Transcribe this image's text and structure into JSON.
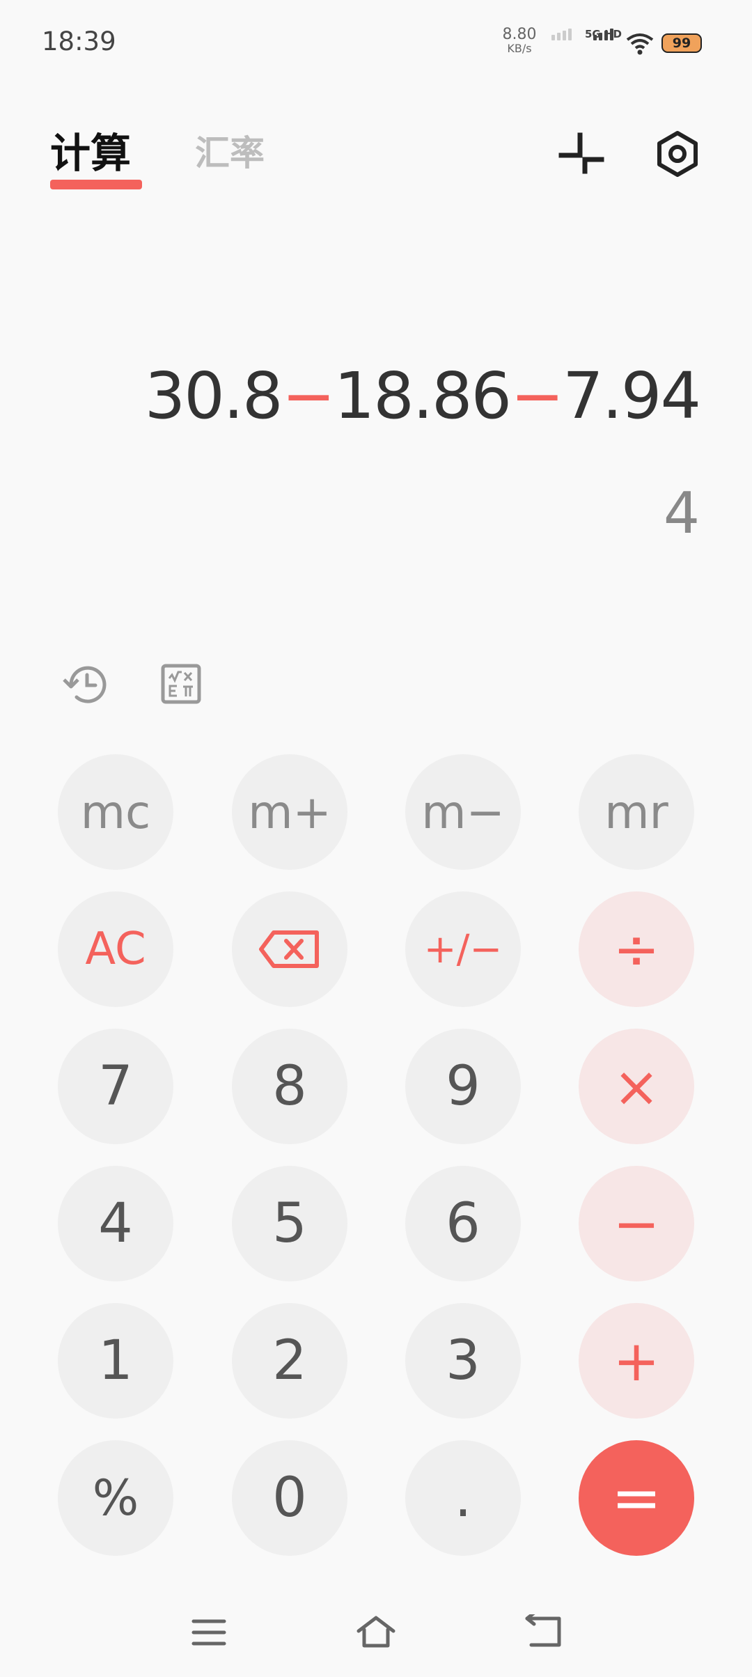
{
  "status": {
    "time": "18:39",
    "speed_value": "8.80",
    "speed_unit": "KB/s",
    "network": "5G HD",
    "battery": "99",
    "battery_color": "#f0a25b"
  },
  "tabs": [
    {
      "label": "计算",
      "active": true
    },
    {
      "label": "汇率",
      "active": false
    }
  ],
  "top_icons": [
    "collapse-icon",
    "settings-icon"
  ],
  "display": {
    "parts": [
      "30.8",
      "−",
      "18.86",
      "−",
      "7.94"
    ],
    "result": "4"
  },
  "tools": [
    "history-icon",
    "scientific-icon"
  ],
  "keys": {
    "row1": [
      "mc",
      "m+",
      "m−",
      "mr"
    ],
    "row2": [
      "AC",
      "backspace-icon",
      "+/−",
      "÷"
    ],
    "row3": [
      "7",
      "8",
      "9",
      "×"
    ],
    "row4": [
      "4",
      "5",
      "6",
      "−"
    ],
    "row5": [
      "1",
      "2",
      "3",
      "+"
    ],
    "row6": [
      "%",
      "0",
      ".",
      "="
    ]
  },
  "navbar": [
    "menu-icon",
    "home-icon",
    "back-icon"
  ],
  "colors": {
    "accent": "#f4625c",
    "key_bg": "#efefef",
    "op_bg": "#f7e6e6"
  }
}
